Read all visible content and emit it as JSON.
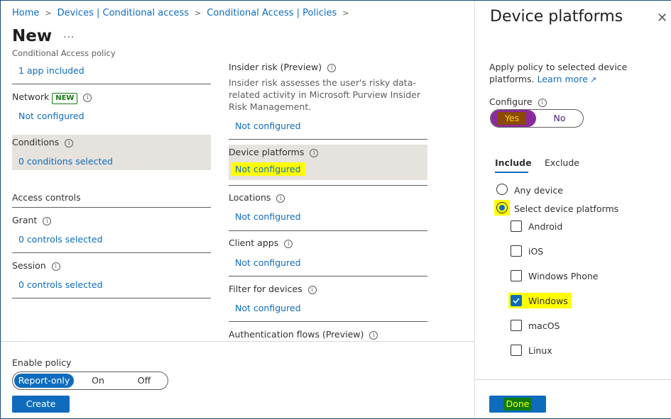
{
  "breadcrumb": [
    "Home",
    "Devices | Conditional access",
    "Conditional Access | Policies"
  ],
  "page": {
    "title": "New",
    "more": "...",
    "subtitle": "Conditional Access policy"
  },
  "left": {
    "apps_value": "1 app included",
    "network": {
      "label": "Network",
      "badge": "NEW",
      "value": "Not configured"
    },
    "conditions": {
      "label": "Conditions",
      "value": "0 conditions selected"
    },
    "access_controls": "Access controls",
    "grant": {
      "label": "Grant",
      "value": "0 controls selected"
    },
    "session": {
      "label": "Session",
      "value": "0 controls selected"
    }
  },
  "conditions_list": {
    "insider_risk": {
      "label": "Insider risk (Preview)",
      "desc": [
        "Insider risk assesses the user's risky data-",
        "related activity in Microsoft Purview Insider",
        "Risk Management."
      ],
      "value": "Not configured"
    },
    "device_platforms": {
      "label": "Device platforms",
      "value": "Not configured"
    },
    "locations": {
      "label": "Locations",
      "value": "Not configured"
    },
    "client_apps": {
      "label": "Client apps",
      "value": "Not configured"
    },
    "filter_devices": {
      "label": "Filter for devices",
      "value": "Not configured"
    },
    "auth_flows": {
      "label": "Authentication flows (Preview)"
    }
  },
  "footer": {
    "enable_label": "Enable policy",
    "options": [
      "Report-only",
      "On",
      "Off"
    ],
    "selected": "Report-only",
    "create_label": "Create"
  },
  "panel": {
    "title": "Device platforms",
    "desc_line1": "Apply policy to selected device",
    "desc_line2": "platforms.",
    "learn_more": "Learn more",
    "configure_label": "Configure",
    "yes": "Yes",
    "no": "No",
    "tabs": [
      "Include",
      "Exclude"
    ],
    "active_tab": "Include",
    "radio_any": "Any device",
    "radio_select": "Select device platforms",
    "platforms": [
      {
        "label": "Android",
        "checked": false
      },
      {
        "label": "iOS",
        "checked": false
      },
      {
        "label": "Windows Phone",
        "checked": false
      },
      {
        "label": "Windows",
        "checked": true
      },
      {
        "label": "macOS",
        "checked": false
      },
      {
        "label": "Linux",
        "checked": false
      }
    ],
    "done_label": "Done"
  },
  "colors": {
    "accent": "#0f6cbd",
    "highlight": "#ffff00",
    "yes_fill": "#8b2a9e",
    "new_badge": "#107c10"
  }
}
